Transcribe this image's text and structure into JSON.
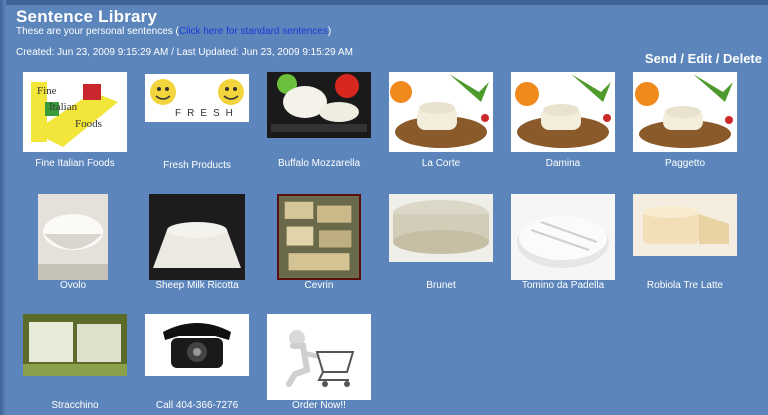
{
  "header": {
    "title": "Sentence Library",
    "subtitle_prefix": "These are your personal sentences (",
    "subtitle_link": "Click here for standard sentences",
    "subtitle_suffix": ")",
    "dates": "Created: Jun 23, 2009 9:15:29 AM / Last Updated: Jun 23, 2009 9:15:29 AM"
  },
  "actions": {
    "send": "Send",
    "sep1": " / ",
    "edit": "Edit",
    "sep2": " / ",
    "delete": "Delete"
  },
  "items": [
    {
      "label": "Fine Italian Foods",
      "icon": "fine-italian-foods-logo"
    },
    {
      "label": "Fresh Products",
      "icon": "fresh-smiley-logo"
    },
    {
      "label": "Buffalo Mozzarella",
      "icon": "mozzarella-photo"
    },
    {
      "label": "La Corte",
      "icon": "cheese-board-photo"
    },
    {
      "label": "Damina",
      "icon": "cheese-board-photo"
    },
    {
      "label": "Paggetto",
      "icon": "cheese-board-photo"
    },
    {
      "label": "Ovolo",
      "icon": "ovolo-cheese-photo"
    },
    {
      "label": "Sheep Milk Ricotta",
      "icon": "ricotta-photo"
    },
    {
      "label": "Cevrin",
      "icon": "cevrin-photo"
    },
    {
      "label": "Brunet",
      "icon": "brunet-photo"
    },
    {
      "label": "Tomino da Padella",
      "icon": "tomino-photo"
    },
    {
      "label": "Robiola Tre Latte",
      "icon": "robiola-photo"
    },
    {
      "label": "Stracchino",
      "icon": "stracchino-photo"
    },
    {
      "label": "Call 404-366-7276",
      "icon": "telephone-photo"
    },
    {
      "label": "Order Now!!",
      "icon": "shopping-cart-figure"
    }
  ]
}
